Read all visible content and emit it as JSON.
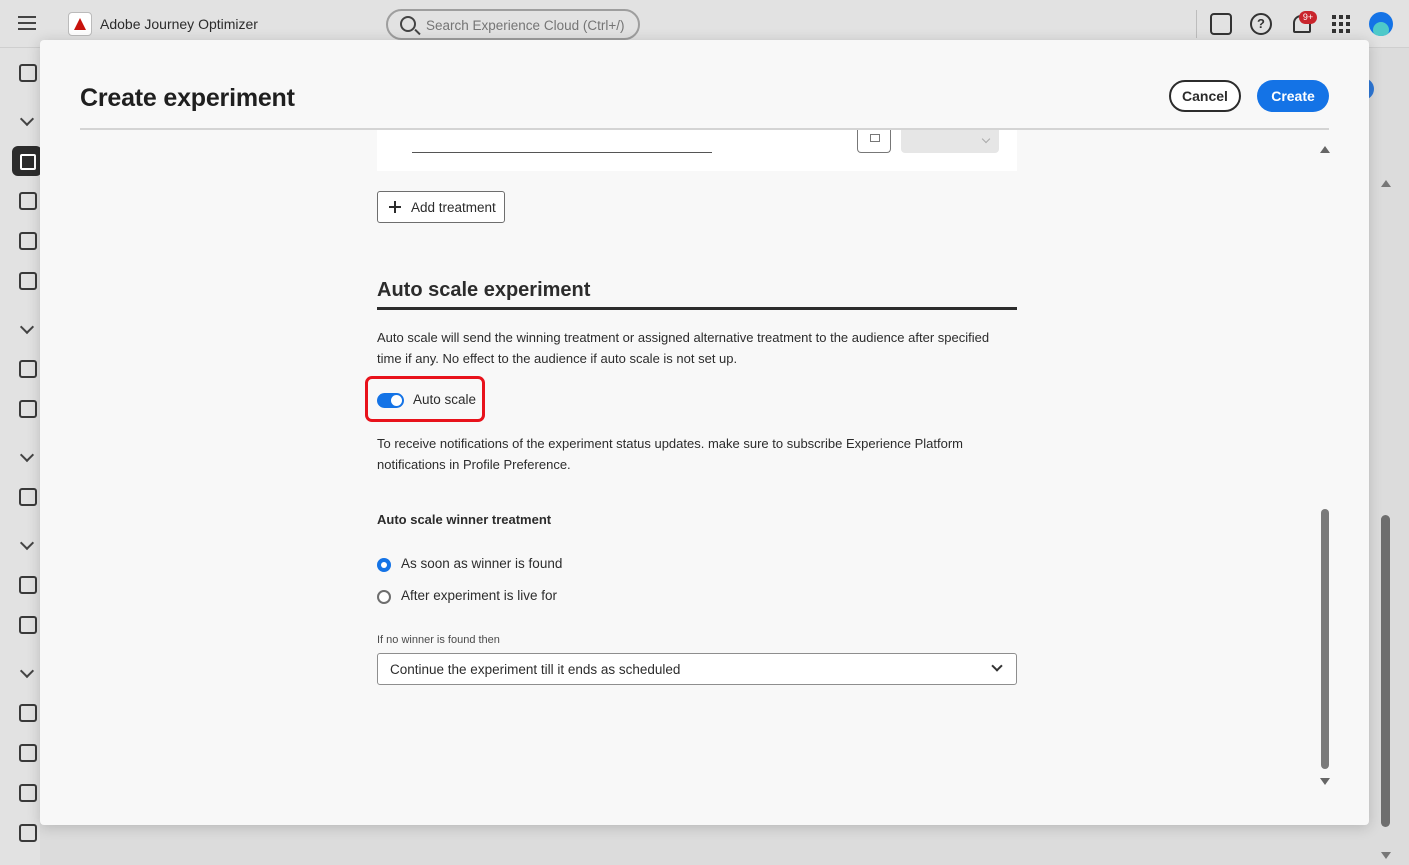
{
  "app": {
    "name": "Adobe Journey Optimizer"
  },
  "search": {
    "placeholder": "Search Experience Cloud (Ctrl+/)"
  },
  "header": {
    "notification_badge": "9+",
    "help_glyph": "?"
  },
  "modal": {
    "title": "Create experiment",
    "cancel_label": "Cancel",
    "create_label": "Create"
  },
  "treatments": {
    "add_label": "Add treatment"
  },
  "auto_scale": {
    "title": "Auto scale experiment",
    "description": "Auto scale will send the winning treatment or assigned alternative treatment to the audience after specified time if any. No effect to the audience if auto scale is not set up.",
    "toggle_label": "Auto scale",
    "toggle_on": true,
    "notice": "To receive notifications of the experiment status updates. make sure to subscribe Experience Platform notifications in Profile Preference.",
    "winner_heading": "Auto scale winner treatment",
    "options": [
      {
        "label": "As soon as winner is found",
        "selected": true
      },
      {
        "label": "After experiment is live for",
        "selected": false
      }
    ],
    "no_winner_label": "If no winner is found then",
    "no_winner_value": "Continue the experiment till it ends as scheduled"
  },
  "colors": {
    "accent": "#1473e6",
    "highlight": "#e8121b",
    "badge": "#c9252c"
  },
  "icons": [
    "menu-icon",
    "adobe-logo-icon",
    "search-icon",
    "chat-icon",
    "help-icon",
    "bell-icon",
    "apps-grid-icon",
    "avatar",
    "home-icon",
    "campaign-icon",
    "journey-icon",
    "plus-icon",
    "calendar-icon",
    "chevron-down-icon"
  ]
}
